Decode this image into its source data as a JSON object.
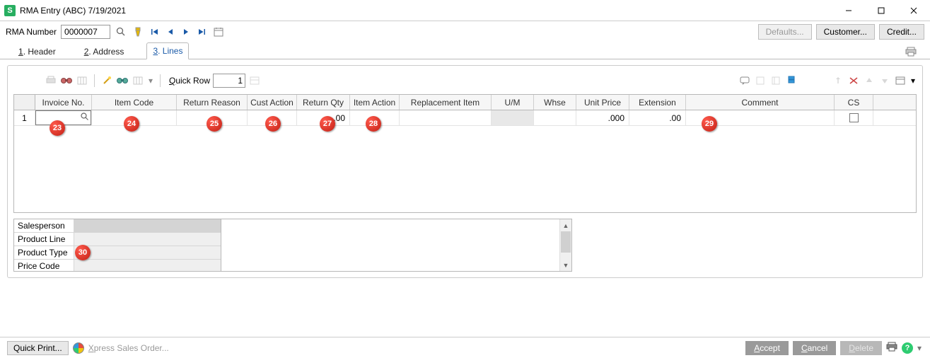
{
  "window": {
    "title": "RMA Entry (ABC) 7/19/2021"
  },
  "header": {
    "rma_label": "RMA Number",
    "rma_value": "0000007",
    "defaults_btn": "Defaults...",
    "customer_btn": "Customer...",
    "credit_btn": "Credit..."
  },
  "tabs": {
    "header": {
      "prefix": "1",
      "label": ". Header"
    },
    "address": {
      "prefix": "2",
      "label": ". Address"
    },
    "lines": {
      "prefix": "3",
      "label": ". Lines"
    }
  },
  "toolbar": {
    "quickrow_prefix": "Q",
    "quickrow_rest": "uick Row",
    "quickrow_value": "1"
  },
  "columns": {
    "invoice": "Invoice No.",
    "item": "Item Code",
    "reason": "Return Reason",
    "cust": "Cust Action",
    "qty": "Return Qty",
    "iact": "Item Action",
    "repl": "Replacement Item",
    "um": "U/M",
    "whse": "Whse",
    "price": "Unit Price",
    "ext": "Extension",
    "cmt": "Comment",
    "cs": "CS"
  },
  "row": {
    "num": "1",
    "qty": ".00",
    "price": ".000",
    "ext": ".00"
  },
  "details": {
    "salesperson": "Salesperson",
    "prodline": "Product Line",
    "prodtype": "Product Type",
    "pricecode": "Price Code"
  },
  "footer": {
    "quickprint": "Quick Print...",
    "xpress_prefix": "X",
    "xpress_rest": "press Sales Order...",
    "accept_prefix": "A",
    "accept_rest": "ccept",
    "cancel_prefix": "C",
    "cancel_rest": "ancel",
    "delete_prefix": "D",
    "delete_rest": "elete"
  },
  "markers": {
    "m23": "23",
    "m24": "24",
    "m25": "25",
    "m26": "26",
    "m27": "27",
    "m28": "28",
    "m29": "29",
    "m30": "30"
  }
}
